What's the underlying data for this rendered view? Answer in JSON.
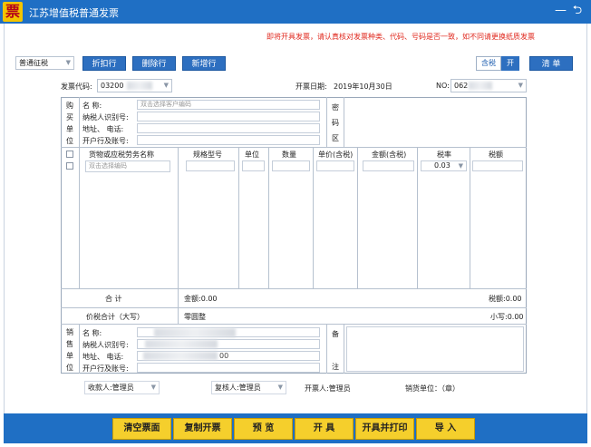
{
  "window": {
    "logo_glyph": "票",
    "title": "江苏增值税普通发票",
    "minimize": "—",
    "back": "⮌"
  },
  "notice": "即将开具发票，请认真核对发票种类、代码、号码是否一致，如不同请更换纸质发票",
  "toolbar": {
    "tax_type": "普通征税",
    "discount_row": "折扣行",
    "delete_row": "删除行",
    "new_row": "新增行",
    "tax_incl_label": "含税",
    "tax_incl_state": "开",
    "list_button": "清 单"
  },
  "invoice": {
    "code_label": "发票代码:",
    "code_value": "03200",
    "date_label": "开票日期:",
    "date_value": "2019年10月30日",
    "no_label": "NO:",
    "no_value": "062"
  },
  "buyer": {
    "vertical_label": [
      "购",
      "买",
      "单",
      "位"
    ],
    "name_label": "名        称:",
    "name_placeholder": "双击选择客户编码",
    "taxid_label": "纳税人识别号:",
    "address_label": "地址、  电话:",
    "bank_label": "开户行及账号:",
    "password_label": [
      "密",
      "码",
      "区"
    ]
  },
  "items": {
    "headers": [
      "货物或应税劳务名称",
      "规格型号",
      "单位",
      "数量",
      "单价(含税)",
      "金额(含税)",
      "税率",
      "税额"
    ],
    "name_placeholder": "双击选择编码",
    "tax_rate": "0.03"
  },
  "totals": {
    "sum_label": "合        计",
    "amount": "金额:0.00",
    "tax": "税额:0.00",
    "total_label": "价税合计（大写）",
    "total_upper": "零圆整",
    "total_lower": "小写:0.00"
  },
  "seller": {
    "vertical_label": [
      "销",
      "售",
      "单",
      "位"
    ],
    "name_label": "名        称:",
    "taxid_label": "纳税人识别号:",
    "address_label": "地址、  电话:",
    "address_partial": "00",
    "bank_label": "开户行及账号:",
    "remark_label": [
      "备",
      "注"
    ]
  },
  "signatures": {
    "payee": "收款人:管理员",
    "reviewer": "复核人:管理员",
    "drawer": "开票人:管理员",
    "seller_unit": "销货单位：（章）"
  },
  "actions": {
    "clear": "清空票面",
    "copy": "复制开票",
    "preview": "预 览",
    "issue": "开 具",
    "issue_print": "开具并打印",
    "import": "导 入"
  },
  "colors": {
    "titlebar": "#1f6fc4",
    "action_button": "#f5cf2c",
    "warning": "#e0281e"
  }
}
